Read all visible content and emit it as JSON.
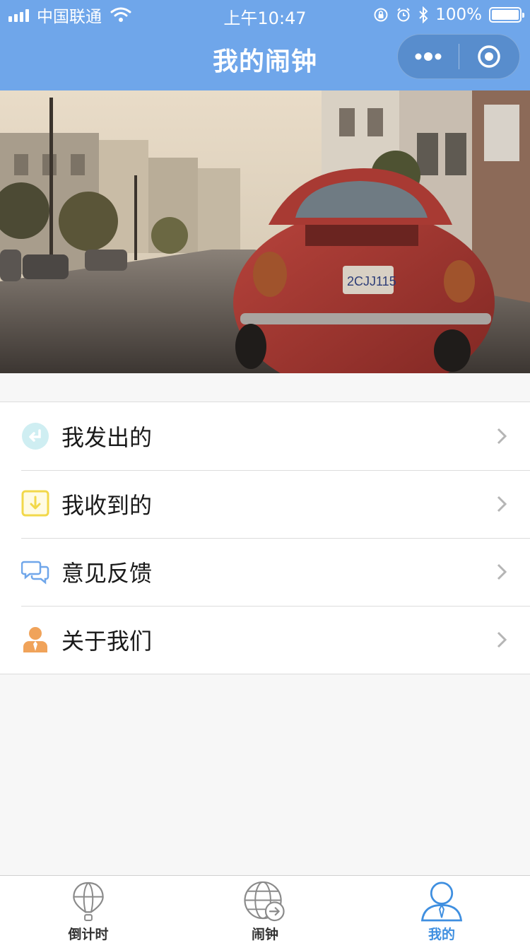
{
  "status_bar": {
    "carrier": "中国联通",
    "time": "上午10:47",
    "battery": "100%",
    "battery_level": 1.0
  },
  "navbar": {
    "title": "我的闹钟"
  },
  "menu": {
    "items": [
      {
        "label": "我发出的",
        "icon": "return-arrow-icon",
        "color": "#8fd8e0"
      },
      {
        "label": "我收到的",
        "icon": "download-box-icon",
        "color": "#f2d84a"
      },
      {
        "label": "意见反馈",
        "icon": "chat-bubbles-icon",
        "color": "#6fa6ea"
      },
      {
        "label": "关于我们",
        "icon": "person-icon",
        "color": "#f0a35a"
      }
    ]
  },
  "tabbar": {
    "tabs": [
      {
        "label": "倒计时",
        "icon": "balloon-icon",
        "active": false
      },
      {
        "label": "闹钟",
        "icon": "globe-arrow-icon",
        "active": false
      },
      {
        "label": "我的",
        "icon": "user-icon",
        "active": true
      }
    ]
  },
  "colors": {
    "brand": "#6fa6ea",
    "active_tab": "#3f8fe0",
    "background": "#f7f7f7"
  }
}
